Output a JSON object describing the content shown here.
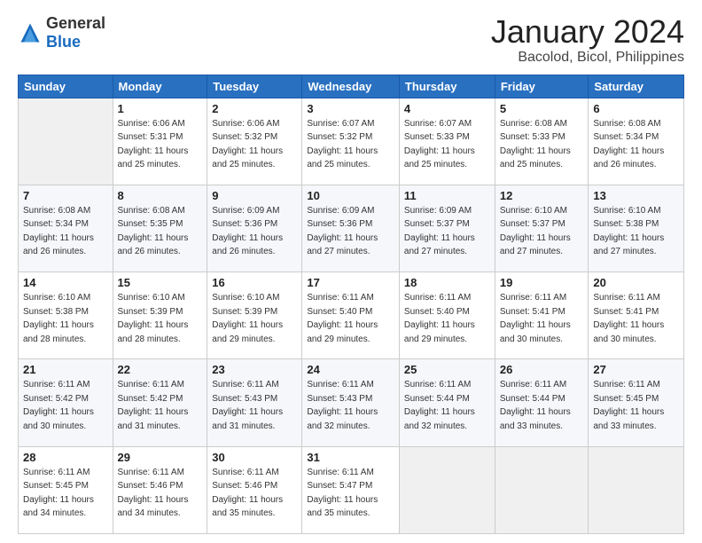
{
  "header": {
    "logo_general": "General",
    "logo_blue": "Blue",
    "month_title": "January 2024",
    "location": "Bacolod, Bicol, Philippines"
  },
  "days_of_week": [
    "Sunday",
    "Monday",
    "Tuesday",
    "Wednesday",
    "Thursday",
    "Friday",
    "Saturday"
  ],
  "weeks": [
    [
      {
        "day": "",
        "info": ""
      },
      {
        "day": "1",
        "info": "Sunrise: 6:06 AM\nSunset: 5:31 PM\nDaylight: 11 hours\nand 25 minutes."
      },
      {
        "day": "2",
        "info": "Sunrise: 6:06 AM\nSunset: 5:32 PM\nDaylight: 11 hours\nand 25 minutes."
      },
      {
        "day": "3",
        "info": "Sunrise: 6:07 AM\nSunset: 5:32 PM\nDaylight: 11 hours\nand 25 minutes."
      },
      {
        "day": "4",
        "info": "Sunrise: 6:07 AM\nSunset: 5:33 PM\nDaylight: 11 hours\nand 25 minutes."
      },
      {
        "day": "5",
        "info": "Sunrise: 6:08 AM\nSunset: 5:33 PM\nDaylight: 11 hours\nand 25 minutes."
      },
      {
        "day": "6",
        "info": "Sunrise: 6:08 AM\nSunset: 5:34 PM\nDaylight: 11 hours\nand 26 minutes."
      }
    ],
    [
      {
        "day": "7",
        "info": "Sunrise: 6:08 AM\nSunset: 5:34 PM\nDaylight: 11 hours\nand 26 minutes."
      },
      {
        "day": "8",
        "info": "Sunrise: 6:08 AM\nSunset: 5:35 PM\nDaylight: 11 hours\nand 26 minutes."
      },
      {
        "day": "9",
        "info": "Sunrise: 6:09 AM\nSunset: 5:36 PM\nDaylight: 11 hours\nand 26 minutes."
      },
      {
        "day": "10",
        "info": "Sunrise: 6:09 AM\nSunset: 5:36 PM\nDaylight: 11 hours\nand 27 minutes."
      },
      {
        "day": "11",
        "info": "Sunrise: 6:09 AM\nSunset: 5:37 PM\nDaylight: 11 hours\nand 27 minutes."
      },
      {
        "day": "12",
        "info": "Sunrise: 6:10 AM\nSunset: 5:37 PM\nDaylight: 11 hours\nand 27 minutes."
      },
      {
        "day": "13",
        "info": "Sunrise: 6:10 AM\nSunset: 5:38 PM\nDaylight: 11 hours\nand 27 minutes."
      }
    ],
    [
      {
        "day": "14",
        "info": "Sunrise: 6:10 AM\nSunset: 5:38 PM\nDaylight: 11 hours\nand 28 minutes."
      },
      {
        "day": "15",
        "info": "Sunrise: 6:10 AM\nSunset: 5:39 PM\nDaylight: 11 hours\nand 28 minutes."
      },
      {
        "day": "16",
        "info": "Sunrise: 6:10 AM\nSunset: 5:39 PM\nDaylight: 11 hours\nand 29 minutes."
      },
      {
        "day": "17",
        "info": "Sunrise: 6:11 AM\nSunset: 5:40 PM\nDaylight: 11 hours\nand 29 minutes."
      },
      {
        "day": "18",
        "info": "Sunrise: 6:11 AM\nSunset: 5:40 PM\nDaylight: 11 hours\nand 29 minutes."
      },
      {
        "day": "19",
        "info": "Sunrise: 6:11 AM\nSunset: 5:41 PM\nDaylight: 11 hours\nand 30 minutes."
      },
      {
        "day": "20",
        "info": "Sunrise: 6:11 AM\nSunset: 5:41 PM\nDaylight: 11 hours\nand 30 minutes."
      }
    ],
    [
      {
        "day": "21",
        "info": "Sunrise: 6:11 AM\nSunset: 5:42 PM\nDaylight: 11 hours\nand 30 minutes."
      },
      {
        "day": "22",
        "info": "Sunrise: 6:11 AM\nSunset: 5:42 PM\nDaylight: 11 hours\nand 31 minutes."
      },
      {
        "day": "23",
        "info": "Sunrise: 6:11 AM\nSunset: 5:43 PM\nDaylight: 11 hours\nand 31 minutes."
      },
      {
        "day": "24",
        "info": "Sunrise: 6:11 AM\nSunset: 5:43 PM\nDaylight: 11 hours\nand 32 minutes."
      },
      {
        "day": "25",
        "info": "Sunrise: 6:11 AM\nSunset: 5:44 PM\nDaylight: 11 hours\nand 32 minutes."
      },
      {
        "day": "26",
        "info": "Sunrise: 6:11 AM\nSunset: 5:44 PM\nDaylight: 11 hours\nand 33 minutes."
      },
      {
        "day": "27",
        "info": "Sunrise: 6:11 AM\nSunset: 5:45 PM\nDaylight: 11 hours\nand 33 minutes."
      }
    ],
    [
      {
        "day": "28",
        "info": "Sunrise: 6:11 AM\nSunset: 5:45 PM\nDaylight: 11 hours\nand 34 minutes."
      },
      {
        "day": "29",
        "info": "Sunrise: 6:11 AM\nSunset: 5:46 PM\nDaylight: 11 hours\nand 34 minutes."
      },
      {
        "day": "30",
        "info": "Sunrise: 6:11 AM\nSunset: 5:46 PM\nDaylight: 11 hours\nand 35 minutes."
      },
      {
        "day": "31",
        "info": "Sunrise: 6:11 AM\nSunset: 5:47 PM\nDaylight: 11 hours\nand 35 minutes."
      },
      {
        "day": "",
        "info": ""
      },
      {
        "day": "",
        "info": ""
      },
      {
        "day": "",
        "info": ""
      }
    ]
  ]
}
